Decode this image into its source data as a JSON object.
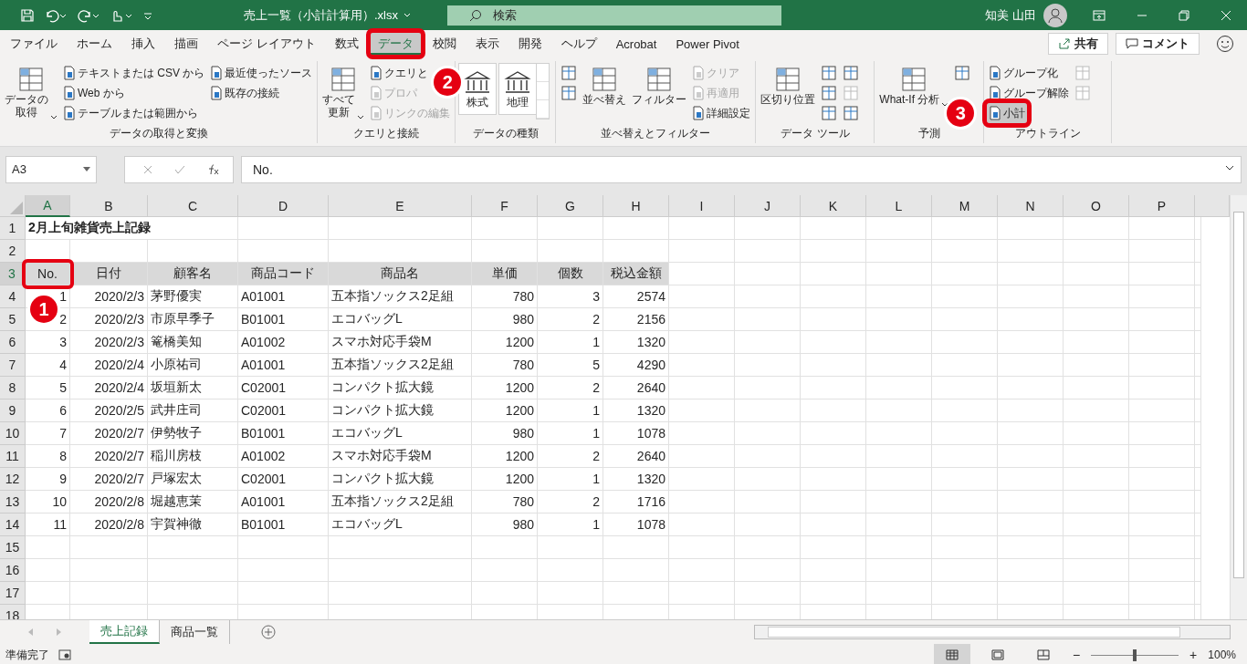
{
  "title_bar": {
    "file_name": "売上一覧（小計計算用）.xlsx",
    "search": {
      "placeholder": "検索"
    },
    "user_name": "知美 山田"
  },
  "ribbon_tabs": [
    {
      "label": "ファイル",
      "selected": false,
      "highlighted": false
    },
    {
      "label": "ホーム",
      "selected": false,
      "highlighted": false
    },
    {
      "label": "挿入",
      "selected": false,
      "highlighted": false
    },
    {
      "label": "描画",
      "selected": false,
      "highlighted": false
    },
    {
      "label": "ページ レイアウト",
      "selected": false,
      "highlighted": false
    },
    {
      "label": "数式",
      "selected": false,
      "highlighted": false
    },
    {
      "label": "データ",
      "selected": true,
      "highlighted": true
    },
    {
      "label": "校閲",
      "selected": false,
      "highlighted": false
    },
    {
      "label": "表示",
      "selected": false,
      "highlighted": false
    },
    {
      "label": "開発",
      "selected": false,
      "highlighted": false
    },
    {
      "label": "ヘルプ",
      "selected": false,
      "highlighted": false
    },
    {
      "label": "Acrobat",
      "selected": false,
      "highlighted": false
    },
    {
      "label": "Power Pivot",
      "selected": false,
      "highlighted": false
    }
  ],
  "share_button": "共有",
  "comment_button": "コメント",
  "ribbon_groups": [
    {
      "label": "データの取得と変換",
      "columns": [
        [
          {
            "kind": "large",
            "label_lines": [
              "データの",
              "取得"
            ],
            "caret": true
          }
        ],
        [
          {
            "kind": "small",
            "label": "テキストまたは CSV から",
            "disabled": false
          },
          {
            "kind": "small",
            "label": "Web から",
            "disabled": false
          },
          {
            "kind": "small",
            "label": "テーブルまたは範囲から",
            "disabled": false
          }
        ],
        [
          {
            "kind": "small",
            "label": "最近使ったソース",
            "disabled": false
          },
          {
            "kind": "small",
            "label": "既存の接続",
            "disabled": false
          }
        ]
      ]
    },
    {
      "label": "クエリと接続",
      "columns": [
        [
          {
            "kind": "large",
            "label_lines": [
              "すべて",
              "更新"
            ],
            "caret": true
          }
        ],
        [
          {
            "kind": "small",
            "label": "クエリと",
            "disabled": false
          },
          {
            "kind": "small",
            "label": "プロパ",
            "disabled": true
          },
          {
            "kind": "small",
            "label": "リンクの編集",
            "disabled": true
          }
        ]
      ]
    },
    {
      "label": "データの種類",
      "columns": [
        [
          {
            "kind": "gallery",
            "label": "株式"
          }
        ],
        [
          {
            "kind": "gallery",
            "label": "地理"
          }
        ]
      ]
    },
    {
      "label": "並べ替えとフィルター",
      "columns": [
        [
          {
            "kind": "icon",
            "disabled": false
          },
          {
            "kind": "icon",
            "disabled": false
          }
        ],
        [
          {
            "kind": "large",
            "label_lines": [
              "並べ替え"
            ],
            "caret": false
          }
        ],
        [
          {
            "kind": "large",
            "label_lines": [
              "フィルター"
            ],
            "caret": false
          }
        ],
        [
          {
            "kind": "small",
            "label": "クリア",
            "disabled": true
          },
          {
            "kind": "small",
            "label": "再適用",
            "disabled": true
          },
          {
            "kind": "small",
            "label": "詳細設定",
            "disabled": false
          }
        ]
      ]
    },
    {
      "label": "データ ツール",
      "columns": [
        [
          {
            "kind": "large",
            "label_lines": [
              "区切り位置"
            ],
            "caret": false
          }
        ],
        [
          {
            "kind": "icon",
            "disabled": false
          },
          {
            "kind": "icon",
            "disabled": false
          },
          {
            "kind": "icon",
            "disabled": false
          }
        ],
        [
          {
            "kind": "icon",
            "disabled": false
          },
          {
            "kind": "icon",
            "disabled": true
          },
          {
            "kind": "icon",
            "disabled": false
          }
        ]
      ]
    },
    {
      "label": "予測",
      "columns": [
        [
          {
            "kind": "large",
            "label_lines": [
              "What-If 分析"
            ],
            "caret": true
          }
        ],
        [
          {
            "kind": "icon",
            "disabled": false
          }
        ]
      ]
    },
    {
      "label": "アウトライン",
      "columns": [
        [
          {
            "kind": "small",
            "label": "グループ化",
            "disabled": false
          },
          {
            "kind": "small",
            "label": "グループ解除",
            "disabled": false
          },
          {
            "kind": "small",
            "label": "小計",
            "disabled": false,
            "highlighted": true
          }
        ],
        [
          {
            "kind": "icon",
            "disabled": true
          },
          {
            "kind": "icon",
            "disabled": true
          }
        ]
      ]
    }
  ],
  "formula_bar": {
    "name_box": "A3",
    "formula": "No."
  },
  "sheet": {
    "columns": [
      {
        "letter": "A",
        "selected": true,
        "numeric": true
      },
      {
        "letter": "B",
        "selected": false,
        "numeric": true
      },
      {
        "letter": "C",
        "selected": false,
        "numeric": false
      },
      {
        "letter": "D",
        "selected": false,
        "numeric": false
      },
      {
        "letter": "E",
        "selected": false,
        "numeric": false
      },
      {
        "letter": "F",
        "selected": false,
        "numeric": true
      },
      {
        "letter": "G",
        "selected": false,
        "numeric": true
      },
      {
        "letter": "H",
        "selected": false,
        "numeric": true
      },
      {
        "letter": "I",
        "selected": false,
        "numeric": false
      },
      {
        "letter": "J",
        "selected": false,
        "numeric": false
      },
      {
        "letter": "K",
        "selected": false,
        "numeric": false
      },
      {
        "letter": "L",
        "selected": false,
        "numeric": false
      },
      {
        "letter": "M",
        "selected": false,
        "numeric": false
      },
      {
        "letter": "N",
        "selected": false,
        "numeric": false
      },
      {
        "letter": "O",
        "selected": false,
        "numeric": false
      },
      {
        "letter": "P",
        "selected": false,
        "numeric": false
      }
    ],
    "rows": [
      {
        "number": "1",
        "kind": "title",
        "selected": false,
        "cells": [
          "2月上旬雑貨売上記録"
        ]
      },
      {
        "number": "2",
        "kind": "empty",
        "selected": false,
        "cells": []
      },
      {
        "number": "3",
        "kind": "header",
        "selected": true,
        "first_cell_highlighted": true,
        "cells": [
          "No.",
          "日付",
          "顧客名",
          "商品コード",
          "商品名",
          "単価",
          "個数",
          "税込金額"
        ]
      },
      {
        "number": "4",
        "kind": "data",
        "selected": false,
        "cells": [
          "1",
          "2020/2/3",
          "茅野優実",
          "A01001",
          "五本指ソックス2足組",
          "780",
          "3",
          "2574"
        ]
      },
      {
        "number": "5",
        "kind": "data",
        "selected": false,
        "cells": [
          "2",
          "2020/2/3",
          "市原早季子",
          "B01001",
          "エコバッグL",
          "980",
          "2",
          "2156"
        ]
      },
      {
        "number": "6",
        "kind": "data",
        "selected": false,
        "cells": [
          "3",
          "2020/2/3",
          "篭橋美知",
          "A01002",
          "スマホ対応手袋M",
          "1200",
          "1",
          "1320"
        ]
      },
      {
        "number": "7",
        "kind": "data",
        "selected": false,
        "cells": [
          "4",
          "2020/2/4",
          "小原祐司",
          "A01001",
          "五本指ソックス2足組",
          "780",
          "5",
          "4290"
        ]
      },
      {
        "number": "8",
        "kind": "data",
        "selected": false,
        "cells": [
          "5",
          "2020/2/4",
          "坂垣新太",
          "C02001",
          "コンパクト拡大鏡",
          "1200",
          "2",
          "2640"
        ]
      },
      {
        "number": "9",
        "kind": "data",
        "selected": false,
        "cells": [
          "6",
          "2020/2/5",
          "武井庄司",
          "C02001",
          "コンパクト拡大鏡",
          "1200",
          "1",
          "1320"
        ]
      },
      {
        "number": "10",
        "kind": "data",
        "selected": false,
        "cells": [
          "7",
          "2020/2/7",
          "伊勢牧子",
          "B01001",
          "エコバッグL",
          "980",
          "1",
          "1078"
        ]
      },
      {
        "number": "11",
        "kind": "data",
        "selected": false,
        "cells": [
          "8",
          "2020/2/7",
          "稲川房枝",
          "A01002",
          "スマホ対応手袋M",
          "1200",
          "2",
          "2640"
        ]
      },
      {
        "number": "12",
        "kind": "data",
        "selected": false,
        "cells": [
          "9",
          "2020/2/7",
          "戸塚宏太",
          "C02001",
          "コンパクト拡大鏡",
          "1200",
          "1",
          "1320"
        ]
      },
      {
        "number": "13",
        "kind": "data",
        "selected": false,
        "cells": [
          "10",
          "2020/2/8",
          "堀越恵茉",
          "A01001",
          "五本指ソックス2足組",
          "780",
          "2",
          "1716"
        ]
      },
      {
        "number": "14",
        "kind": "data",
        "selected": false,
        "cells": [
          "11",
          "2020/2/8",
          "宇賀神徹",
          "B01001",
          "エコバッグL",
          "980",
          "1",
          "1078"
        ]
      },
      {
        "number": "15",
        "kind": "empty",
        "selected": false,
        "cells": []
      },
      {
        "number": "16",
        "kind": "empty",
        "selected": false,
        "cells": []
      },
      {
        "number": "17",
        "kind": "empty",
        "selected": false,
        "cells": []
      },
      {
        "number": "18",
        "kind": "empty",
        "selected": false,
        "cells": []
      }
    ]
  },
  "sheet_tabs": [
    {
      "label": "売上記録",
      "selected": true
    },
    {
      "label": "商品一覧",
      "selected": false
    }
  ],
  "status_bar": {
    "status": "準備完了",
    "zoom": {
      "out_label": "−",
      "in_label": "+",
      "level": 0.5,
      "reading": "100%"
    }
  },
  "callouts": [
    "1",
    "2",
    "3"
  ]
}
